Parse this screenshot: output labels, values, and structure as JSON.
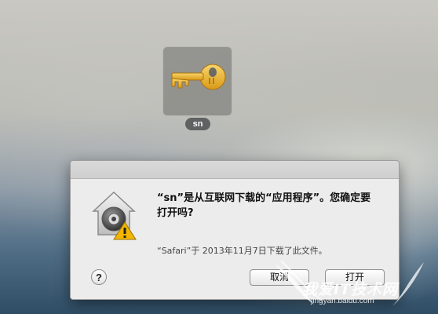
{
  "desktop": {
    "file": {
      "label": "sn",
      "icon": "key-icon"
    }
  },
  "dialog": {
    "message": "“sn”是从互联网下载的“应用程序”。您确定要打开吗?",
    "info": "“Safari”于 2013年11月7日下载了此文件。",
    "help_label": "?",
    "cancel_label": "取消",
    "open_label": "打开",
    "icon": "gatekeeper-warning-icon"
  },
  "watermark": {
    "text": "我爱IT技术网",
    "sub": "jingyan.baidu.com"
  },
  "colors": {
    "key": "#e9b52f",
    "warning": "#f2b600",
    "dialog_bg": "#ececec"
  }
}
